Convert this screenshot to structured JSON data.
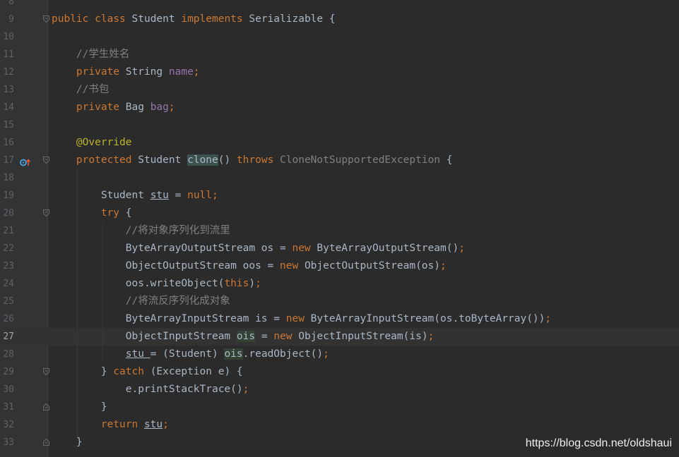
{
  "editor": {
    "current_line": "27",
    "lines": [
      {
        "num": "8",
        "segments": []
      },
      {
        "num": "9",
        "segments": [
          {
            "t": "public class ",
            "c": "kw"
          },
          {
            "t": "Student ",
            "c": ""
          },
          {
            "t": "implements ",
            "c": "kw"
          },
          {
            "t": "Serializable {",
            "c": ""
          }
        ]
      },
      {
        "num": "10",
        "segments": []
      },
      {
        "num": "11",
        "segments": [
          {
            "t": "    //学生姓名",
            "c": "cmt"
          }
        ]
      },
      {
        "num": "12",
        "segments": [
          {
            "t": "    private ",
            "c": "kw"
          },
          {
            "t": "String ",
            "c": ""
          },
          {
            "t": "name",
            "c": "fld"
          },
          {
            "t": ";",
            "c": "kw"
          }
        ]
      },
      {
        "num": "13",
        "segments": [
          {
            "t": "    //书包",
            "c": "cmt"
          }
        ]
      },
      {
        "num": "14",
        "segments": [
          {
            "t": "    private ",
            "c": "kw"
          },
          {
            "t": "Bag ",
            "c": ""
          },
          {
            "t": "bag",
            "c": "fld"
          },
          {
            "t": ";",
            "c": "kw"
          }
        ]
      },
      {
        "num": "15",
        "segments": []
      },
      {
        "num": "16",
        "segments": [
          {
            "t": "    @Override",
            "c": "ann"
          }
        ]
      },
      {
        "num": "17",
        "segments": [
          {
            "t": "    protected ",
            "c": "kw"
          },
          {
            "t": "Student ",
            "c": ""
          },
          {
            "t": "clone",
            "c": "hl-clone"
          },
          {
            "t": "() ",
            "c": ""
          },
          {
            "t": "throws ",
            "c": "kw"
          },
          {
            "t": "CloneNotSupportedException",
            "c": "gray"
          },
          {
            "t": " {",
            "c": ""
          }
        ]
      },
      {
        "num": "18",
        "segments": []
      },
      {
        "num": "19",
        "segments": [
          {
            "t": "        Student ",
            "c": ""
          },
          {
            "t": "stu",
            "c": "ul"
          },
          {
            "t": " = ",
            "c": ""
          },
          {
            "t": "null;",
            "c": "kw"
          }
        ]
      },
      {
        "num": "20",
        "segments": [
          {
            "t": "        try ",
            "c": "kw"
          },
          {
            "t": "{",
            "c": ""
          }
        ]
      },
      {
        "num": "21",
        "segments": [
          {
            "t": "            //将对象序列化到流里",
            "c": "cmt"
          }
        ]
      },
      {
        "num": "22",
        "segments": [
          {
            "t": "            ByteArrayOutputStream os = ",
            "c": ""
          },
          {
            "t": "new ",
            "c": "kw"
          },
          {
            "t": "ByteArrayOutputStream()",
            "c": ""
          },
          {
            "t": ";",
            "c": "kw"
          }
        ]
      },
      {
        "num": "23",
        "segments": [
          {
            "t": "            ObjectOutputStream oos = ",
            "c": ""
          },
          {
            "t": "new ",
            "c": "kw"
          },
          {
            "t": "ObjectOutputStream(os)",
            "c": ""
          },
          {
            "t": ";",
            "c": "kw"
          }
        ]
      },
      {
        "num": "24",
        "segments": [
          {
            "t": "            oos.writeObject(",
            "c": ""
          },
          {
            "t": "this",
            "c": "kw"
          },
          {
            "t": ")",
            "c": ""
          },
          {
            "t": ";",
            "c": "kw"
          }
        ]
      },
      {
        "num": "25",
        "segments": [
          {
            "t": "            //将流反序列化成对象",
            "c": "cmt"
          }
        ]
      },
      {
        "num": "26",
        "segments": [
          {
            "t": "            ByteArrayInputStream is = ",
            "c": ""
          },
          {
            "t": "new ",
            "c": "kw"
          },
          {
            "t": "ByteArrayInputStream(os.toByteArray())",
            "c": ""
          },
          {
            "t": ";",
            "c": "kw"
          }
        ]
      },
      {
        "num": "27",
        "segments": [
          {
            "t": "            ObjectInputStream ",
            "c": ""
          },
          {
            "t": "ois",
            "c": "hl"
          },
          {
            "t": " = ",
            "c": ""
          },
          {
            "t": "new ",
            "c": "kw"
          },
          {
            "t": "ObjectInputStream(is)",
            "c": ""
          },
          {
            "t": ";",
            "c": "kw"
          }
        ]
      },
      {
        "num": "28",
        "segments": [
          {
            "t": "            ",
            "c": ""
          },
          {
            "t": "stu ",
            "c": "ul"
          },
          {
            "t": "= (Student) ",
            "c": ""
          },
          {
            "t": "ois",
            "c": "hl"
          },
          {
            "t": ".readObject()",
            "c": ""
          },
          {
            "t": ";",
            "c": "kw"
          }
        ]
      },
      {
        "num": "29",
        "segments": [
          {
            "t": "        } ",
            "c": ""
          },
          {
            "t": "catch ",
            "c": "kw"
          },
          {
            "t": "(Exception e) {",
            "c": ""
          }
        ]
      },
      {
        "num": "30",
        "segments": [
          {
            "t": "            e.printStackTrace()",
            "c": ""
          },
          {
            "t": ";",
            "c": "kw"
          }
        ]
      },
      {
        "num": "31",
        "segments": [
          {
            "t": "        }",
            "c": ""
          }
        ]
      },
      {
        "num": "32",
        "segments": [
          {
            "t": "        return ",
            "c": "kw"
          },
          {
            "t": "stu",
            "c": "ul"
          },
          {
            "t": ";",
            "c": "kw"
          }
        ]
      },
      {
        "num": "33",
        "segments": [
          {
            "t": "    }",
            "c": ""
          }
        ]
      }
    ],
    "fold_markers": [
      {
        "line": "9",
        "kind": "open"
      },
      {
        "line": "17",
        "kind": "open"
      },
      {
        "line": "20",
        "kind": "open"
      },
      {
        "line": "29",
        "kind": "open"
      },
      {
        "line": "31",
        "kind": "close"
      },
      {
        "line": "33",
        "kind": "close"
      }
    ],
    "gutter_icon": {
      "line": "17",
      "icon": "override-method-icon"
    }
  },
  "watermark": "https://blog.csdn.net/oldshaui"
}
